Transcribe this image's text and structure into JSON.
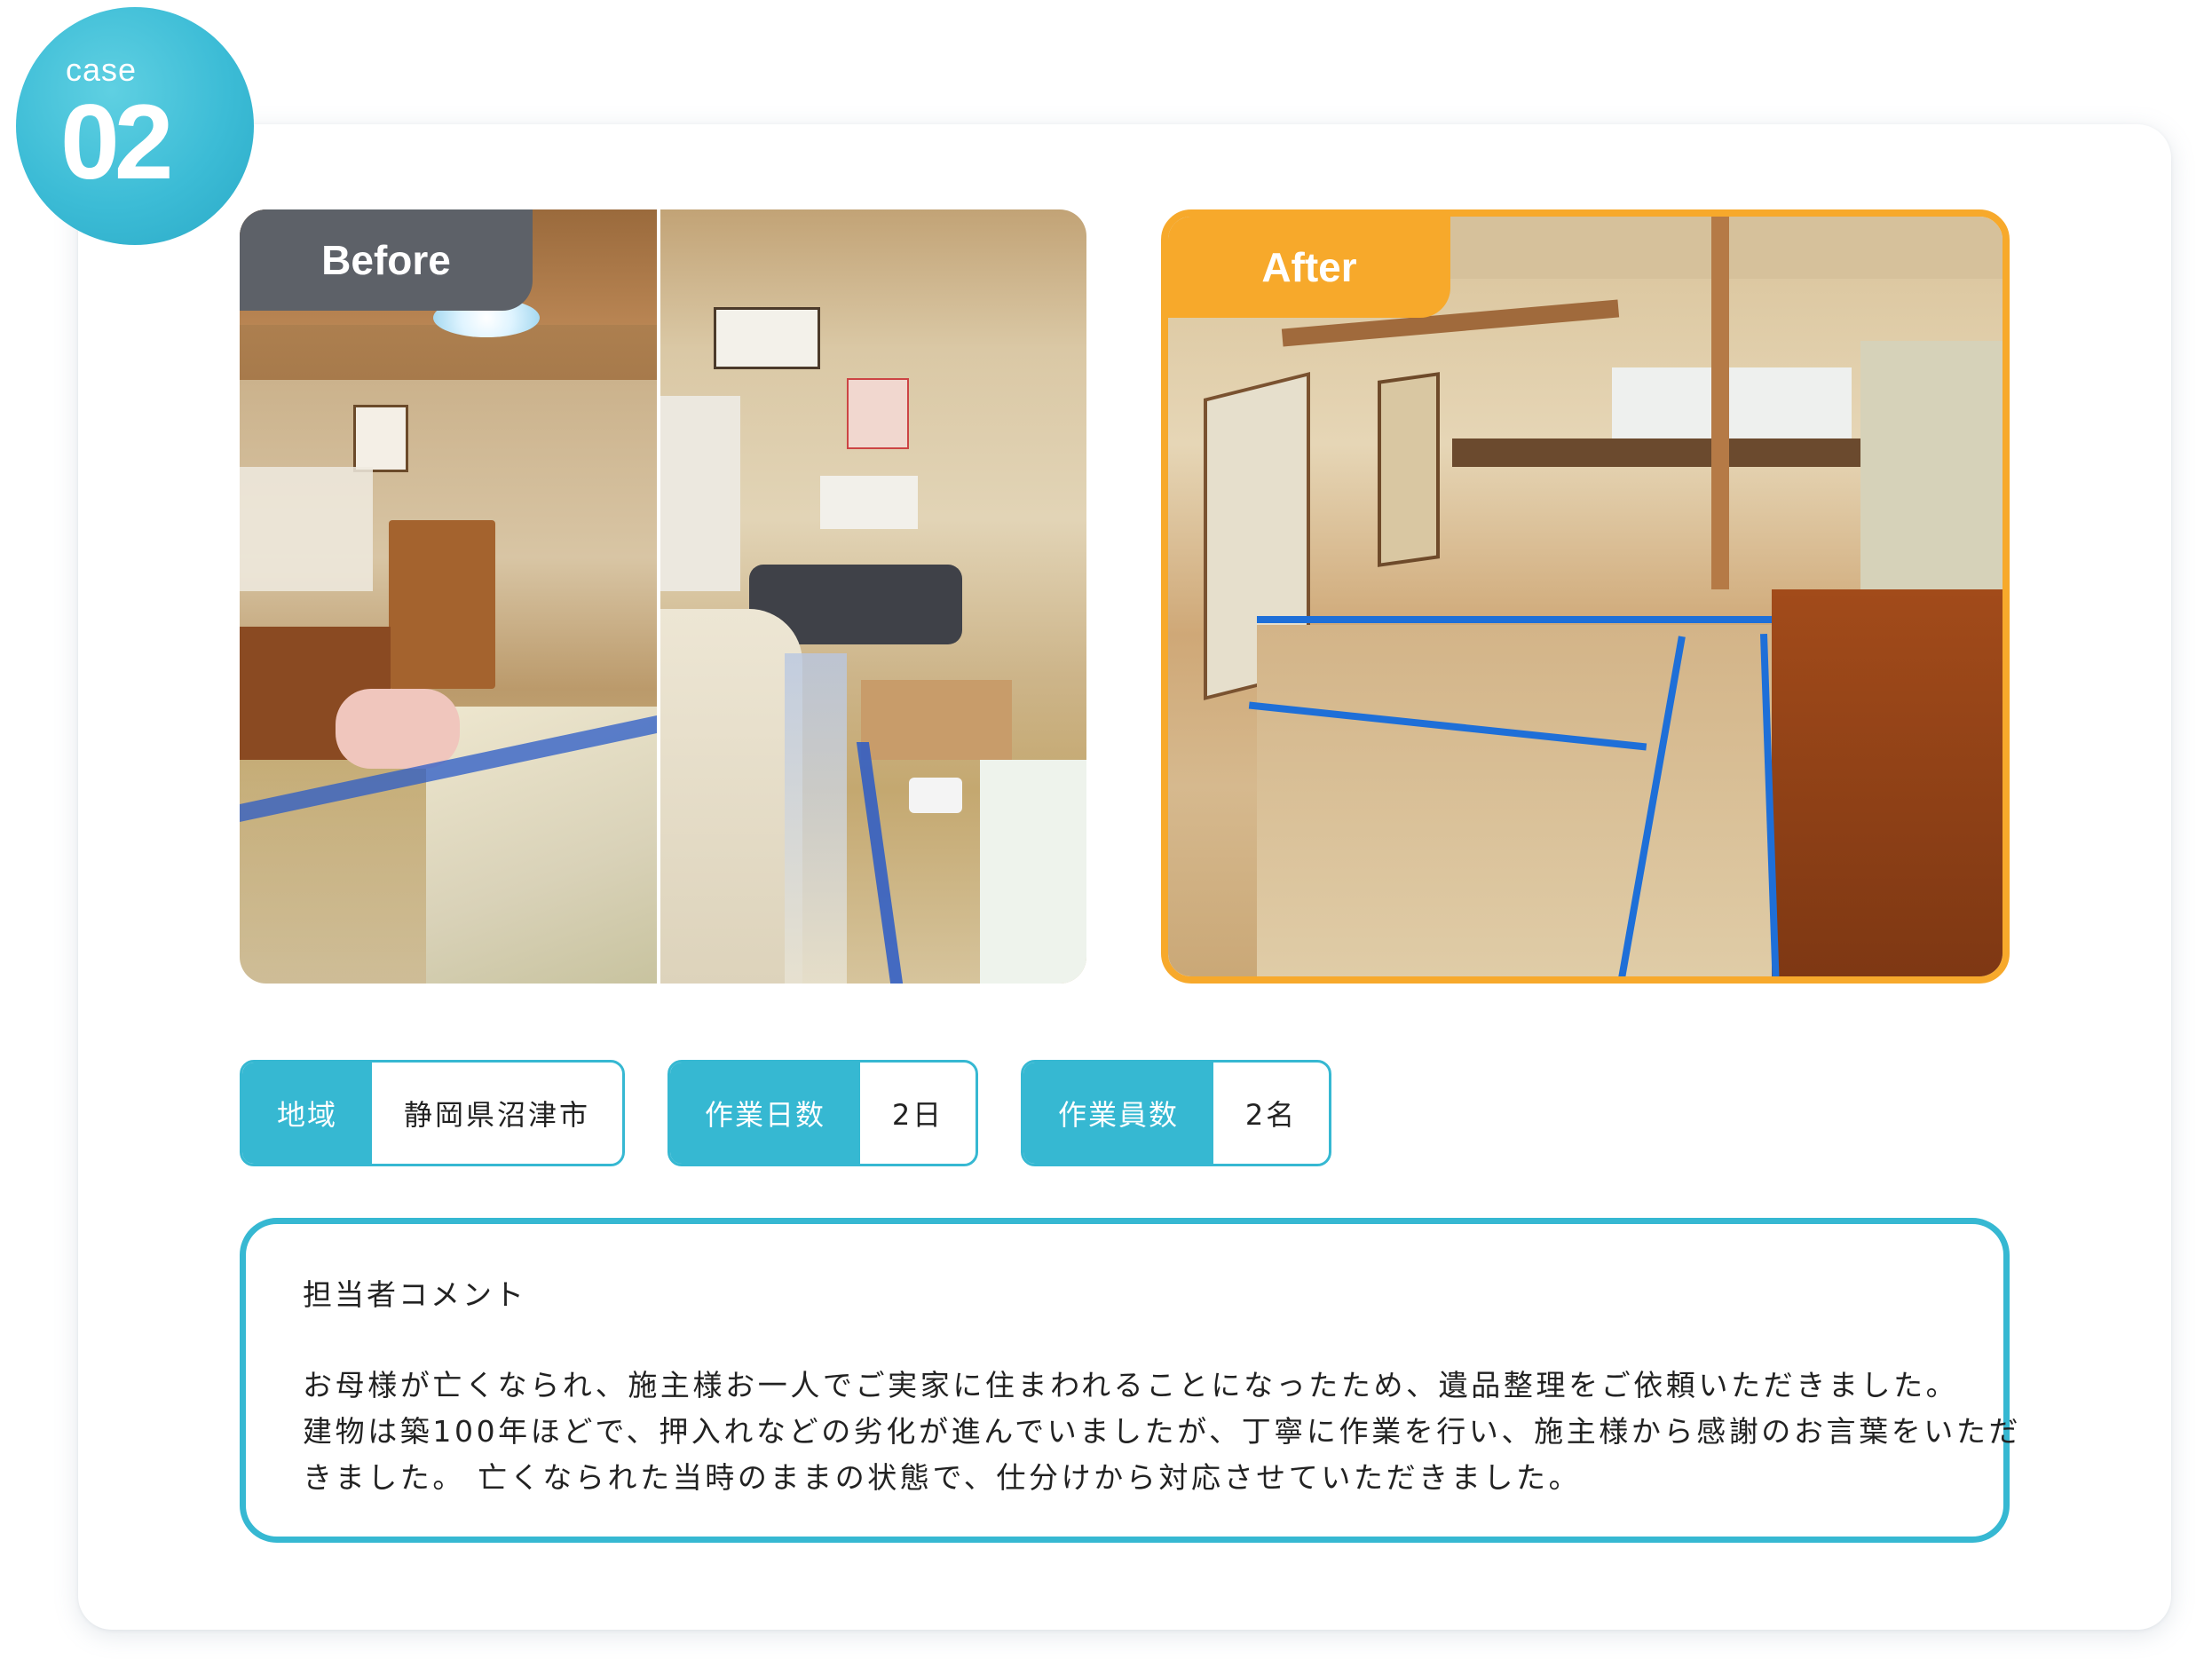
{
  "badge": {
    "word": "case",
    "number": "02"
  },
  "photos": {
    "before_label": "Before",
    "after_label": "After"
  },
  "info": [
    {
      "label": "地域",
      "value": "静岡県沼津市"
    },
    {
      "label": "作業日数",
      "value": "2日"
    },
    {
      "label": "作業員数",
      "value": "2名"
    }
  ],
  "comment": {
    "title": "担当者コメント",
    "lines": [
      "お母様が亡くなられ、施主様お一人でご実家に住まわれることになったため、遺品整理をご依頼いただきました。",
      "建物は築100年ほどで、押入れなどの劣化が進んでいましたが、丁寧に作業を行い、施主様から感謝のお言葉をいただ",
      "きました。 亡くなられた当時のままの状態で、仕分けから対応させていただきました。"
    ]
  },
  "colors": {
    "accent": "#36b8d2",
    "before_tag": "#5d6168",
    "after_tag": "#f7a92b"
  }
}
